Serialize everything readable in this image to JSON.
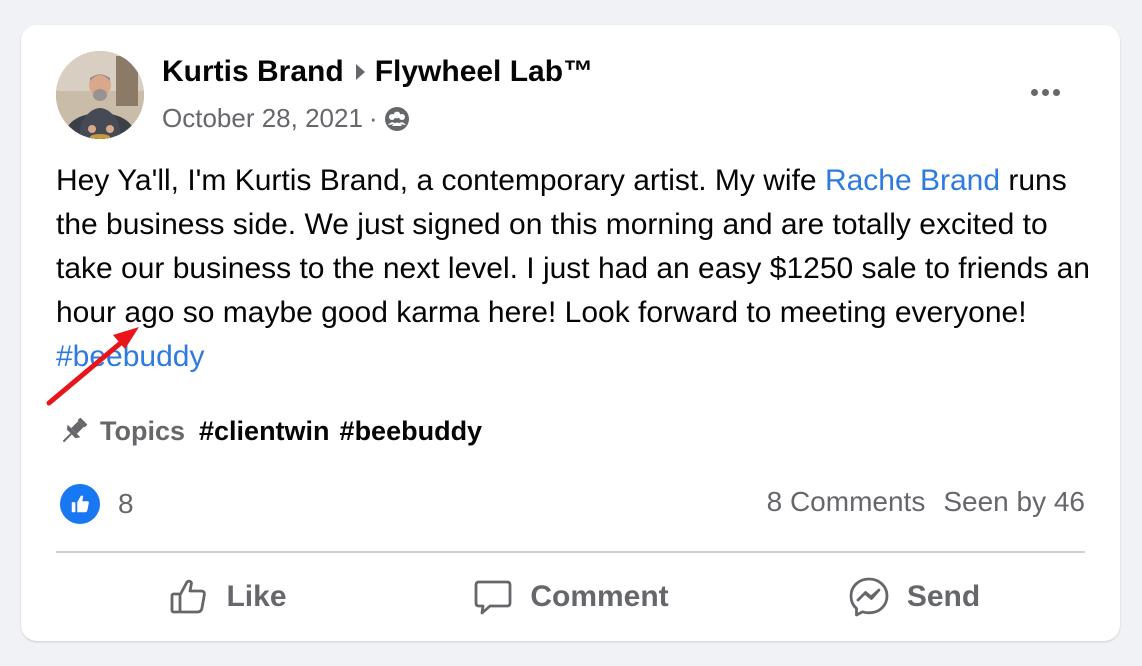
{
  "post": {
    "author": "Kurtis Brand",
    "group": "Flywheel Lab™",
    "date": "October 28, 2021",
    "separator": "·",
    "audience_icon": "group-icon",
    "more_icon": "more-icon",
    "body": {
      "part1": "Hey Ya'll, I'm Kurtis Brand, a contemporary artist. My wife ",
      "mention": "Rache Brand",
      "part2": " runs the business side. We just signed on this morning and are totally excited to take our business to the next level. I just had an easy $1250 sale to friends an hour ago so maybe good karma here! Look forward to meeting everyone! ",
      "hashtag": "#beebuddy"
    },
    "annotation_color": "#e8151b"
  },
  "topics": {
    "icon": "pin-icon",
    "label": "Topics",
    "tags": [
      "#clientwin",
      "#beebuddy"
    ]
  },
  "reactions": {
    "icon": "like-reaction-icon",
    "count": "8"
  },
  "stats": {
    "comments": "8 Comments",
    "seen": "Seen by 46"
  },
  "actions": {
    "like": "Like",
    "comment": "Comment",
    "send": "Send"
  },
  "colors": {
    "link": "#2d7ae0",
    "like_blue": "#1877f2",
    "secondary_text": "#65676b"
  }
}
